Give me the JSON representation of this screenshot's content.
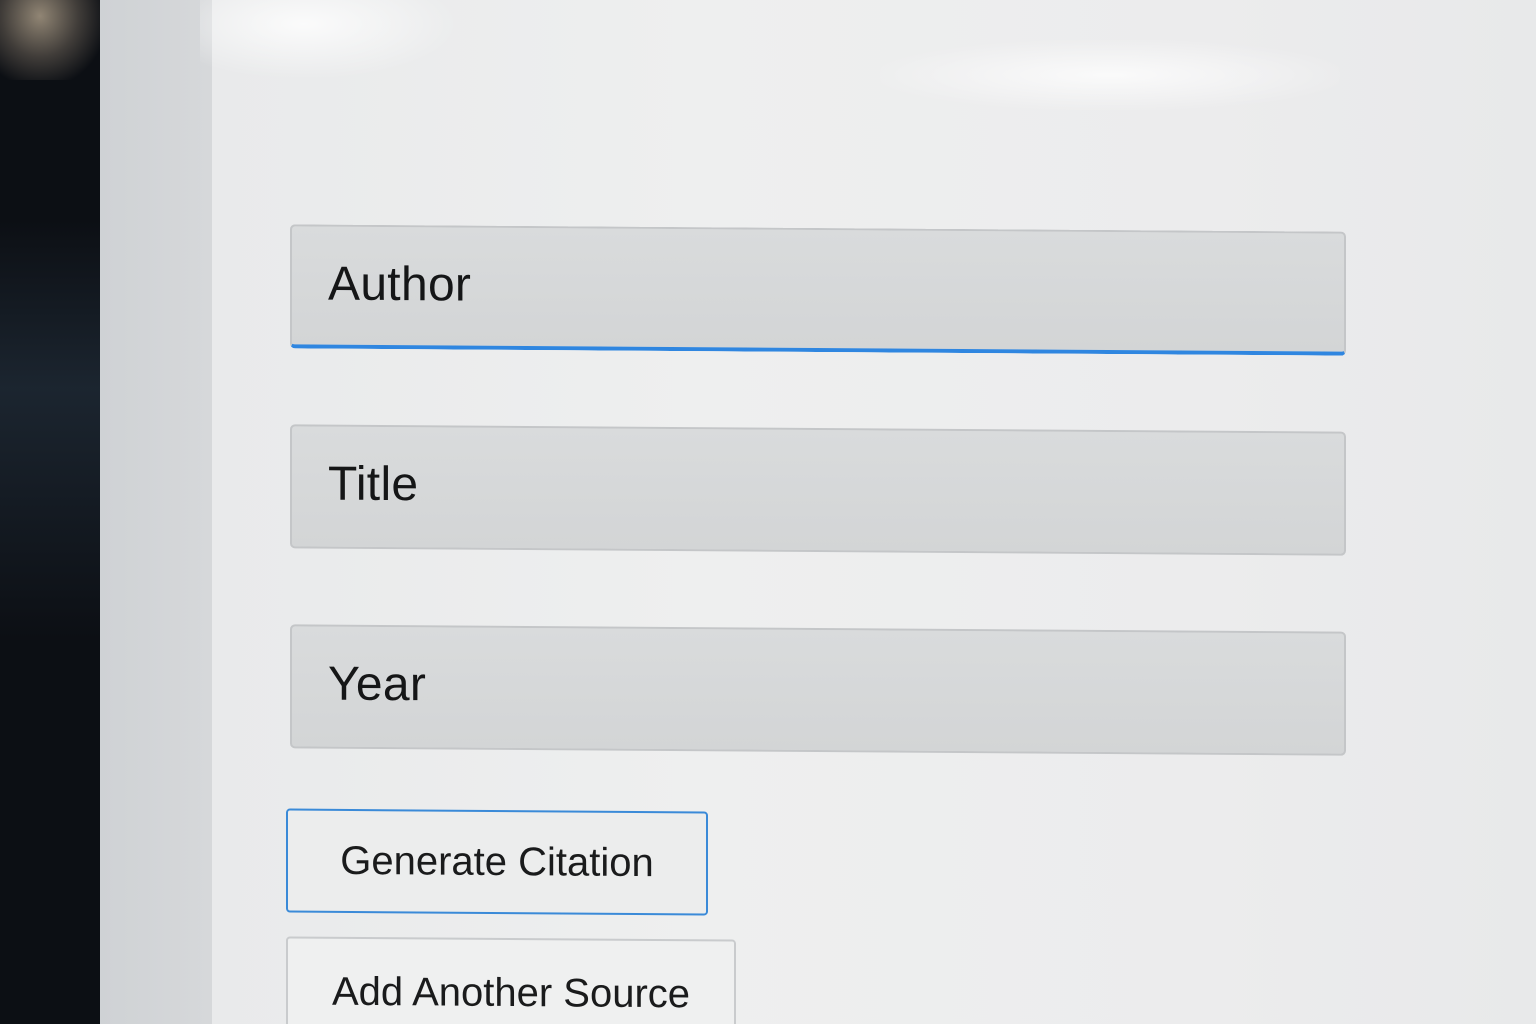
{
  "form": {
    "fields": [
      {
        "label": "Author",
        "focused": true
      },
      {
        "label": "Title",
        "focused": false
      },
      {
        "label": "Year",
        "focused": false
      }
    ],
    "buttons": {
      "generate_label": "Generate Citation",
      "add_source_label": "Add Another Source"
    }
  },
  "colors": {
    "focus_accent": "#2f86e0",
    "primary_button_border": "#3a8ad8",
    "field_background": "#d6d8d9"
  }
}
